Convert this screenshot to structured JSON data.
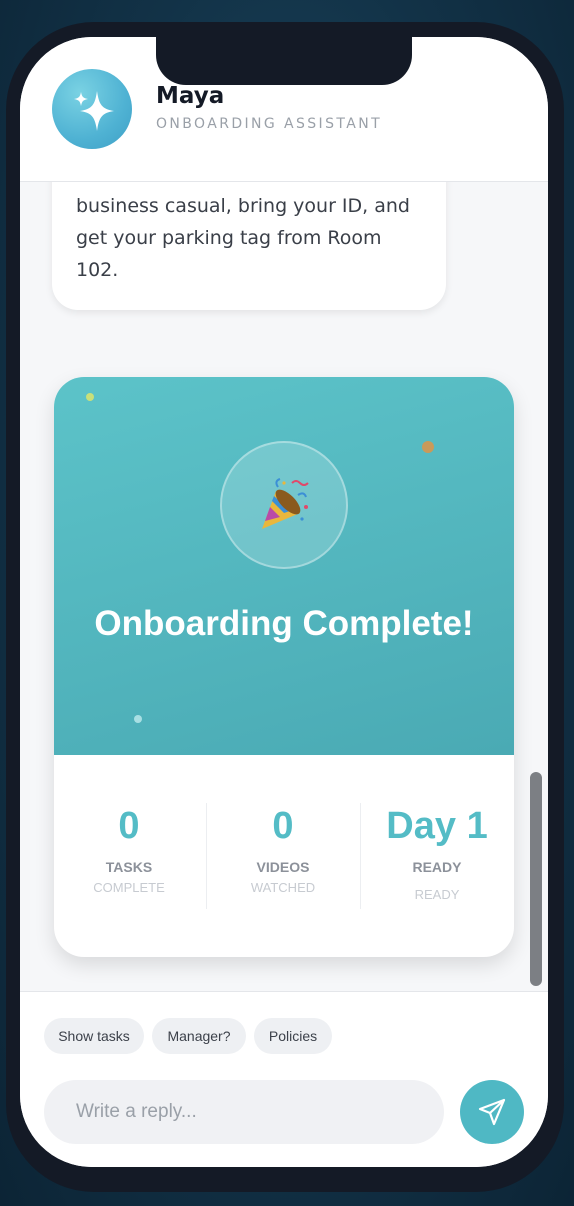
{
  "header": {
    "name": "Maya",
    "role": "ONBOARDING ASSISTANT",
    "avatar_icon": "sparkles-icon"
  },
  "message": {
    "text": "business casual, bring your ID, and get your parking tag from Room 102."
  },
  "card": {
    "icon": "party-popper-icon",
    "title": "Onboarding Complete!",
    "stats": [
      {
        "value": "0",
        "label": "TASKS",
        "sub": "COMPLETE"
      },
      {
        "value": "0",
        "label": "VIDEOS",
        "sub": "WATCHED"
      },
      {
        "value": "Day 1",
        "label": "READY",
        "sub": "READY"
      }
    ]
  },
  "quick_replies": [
    "Show tasks",
    "Manager?",
    "Policies"
  ],
  "composer": {
    "placeholder": "Write a reply...",
    "send_icon": "send-icon"
  },
  "colors": {
    "accent": "#54bcc6",
    "card_gradient_start": "#5cc3c9",
    "card_gradient_end": "#4aaab4",
    "phone_frame": "#141a26"
  }
}
